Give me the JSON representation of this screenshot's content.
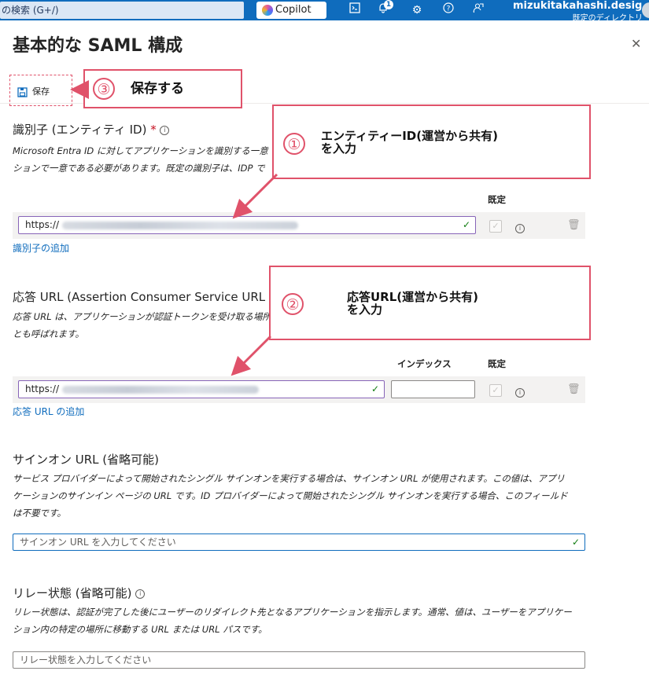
{
  "topbar": {
    "search_text": "の検索 (G+/)",
    "copilot_label": "Copilot",
    "notification_count": "1",
    "user_name": "mizukitakahashi.desig…",
    "user_directory": "既定のディレクトリ"
  },
  "panel": {
    "title": "基本的な SAML 構成",
    "save_label": "保存"
  },
  "callouts": {
    "c1_num": "①",
    "c1_text_line1": "エンティティーID(運営から共有)",
    "c1_text_line2": "を入力",
    "c2_num": "②",
    "c2_text_line1": "応答URL(運営から共有)",
    "c2_text_line2": "を入力",
    "c3_num": "③",
    "c3_text": "保存する",
    "color": "#e0526a"
  },
  "identifier": {
    "title": "識別子 (エンティティ ID)",
    "required_mark": "*",
    "desc_line1": "Microsoft Entra ID に対してアプリケーションを識別する一意",
    "desc_line2": "ションで一意である必要があります。既定の識別子は、IDP で",
    "default_header": "既定",
    "value_prefix": "https://",
    "add_link": "識別子の追加"
  },
  "reply_url": {
    "title": "応答 URL (Assertion Consumer Service URL",
    "desc_line1": "応答 URL は、アプリケーションが認証トークンを受け取る場所",
    "desc_line2": "とも呼ばれます。",
    "index_header": "インデックス",
    "default_header": "既定",
    "value_prefix": "https://",
    "add_link": "応答 URL の追加"
  },
  "signon": {
    "title": "サインオン URL (省略可能)",
    "desc_line1": "サービス プロバイダーによって開始されたシングル サインオンを実行する場合は、サインオン URL が使用されます。この値は、アプリ",
    "desc_line2": "ケーションのサインイン ページの URL です。ID プロバイダーによって開始されたシングル サインオンを実行する場合、このフィールド",
    "desc_line3": "は不要です。",
    "placeholder": "サインオン URL を入力してください"
  },
  "relay": {
    "title": "リレー状態 (省略可能)",
    "desc_line1": "リレー状態は、認証が完了した後にユーザーのリダイレクト先となるアプリケーションを指示します。通常、値は、ユーザーをアプリケー",
    "desc_line2": "ション内の特定の場所に移動する URL または URL パスです。",
    "placeholder": "リレー状態を入力してください"
  },
  "icons": {
    "save": "save-icon",
    "close": "close-icon",
    "info": "info-icon",
    "trash": "trash-icon",
    "check": "checkmark-icon"
  }
}
